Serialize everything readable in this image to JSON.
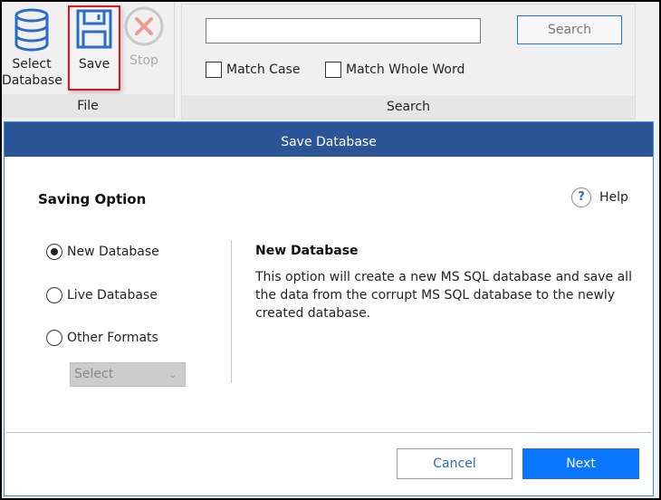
{
  "ribbon": {
    "file_group": {
      "label": "File",
      "buttons": [
        {
          "label_line1": "Select",
          "label_line2": "Database",
          "icon": "database-icon"
        },
        {
          "label": "Save",
          "icon": "floppy-disk-icon",
          "highlighted": true
        },
        {
          "label": "Stop",
          "icon": "stop-x-icon",
          "disabled": true
        }
      ]
    },
    "search_group": {
      "label": "Search",
      "input_value": "",
      "search_button": "Search",
      "match_case": {
        "label": "Match Case",
        "checked": false
      },
      "match_whole_word": {
        "label": "Match Whole Word",
        "checked": false
      }
    }
  },
  "dialog": {
    "title": "Save Database",
    "section_title": "Saving Option",
    "help_label": "Help",
    "options": [
      {
        "label": "New Database",
        "selected": true
      },
      {
        "label": "Live Database",
        "selected": false
      },
      {
        "label": "Other Formats",
        "selected": false
      }
    ],
    "format_select": {
      "value": "Select",
      "disabled": true
    },
    "description": {
      "title": "New Database",
      "text": "This option will create a new MS SQL database and save all the data from the corrupt MS SQL database to the newly created database."
    },
    "cancel_label": "Cancel",
    "next_label": "Next"
  },
  "colors": {
    "title_bar": "#2b5597",
    "primary_button": "#0a77ff",
    "highlight_border": "#e0141e"
  }
}
